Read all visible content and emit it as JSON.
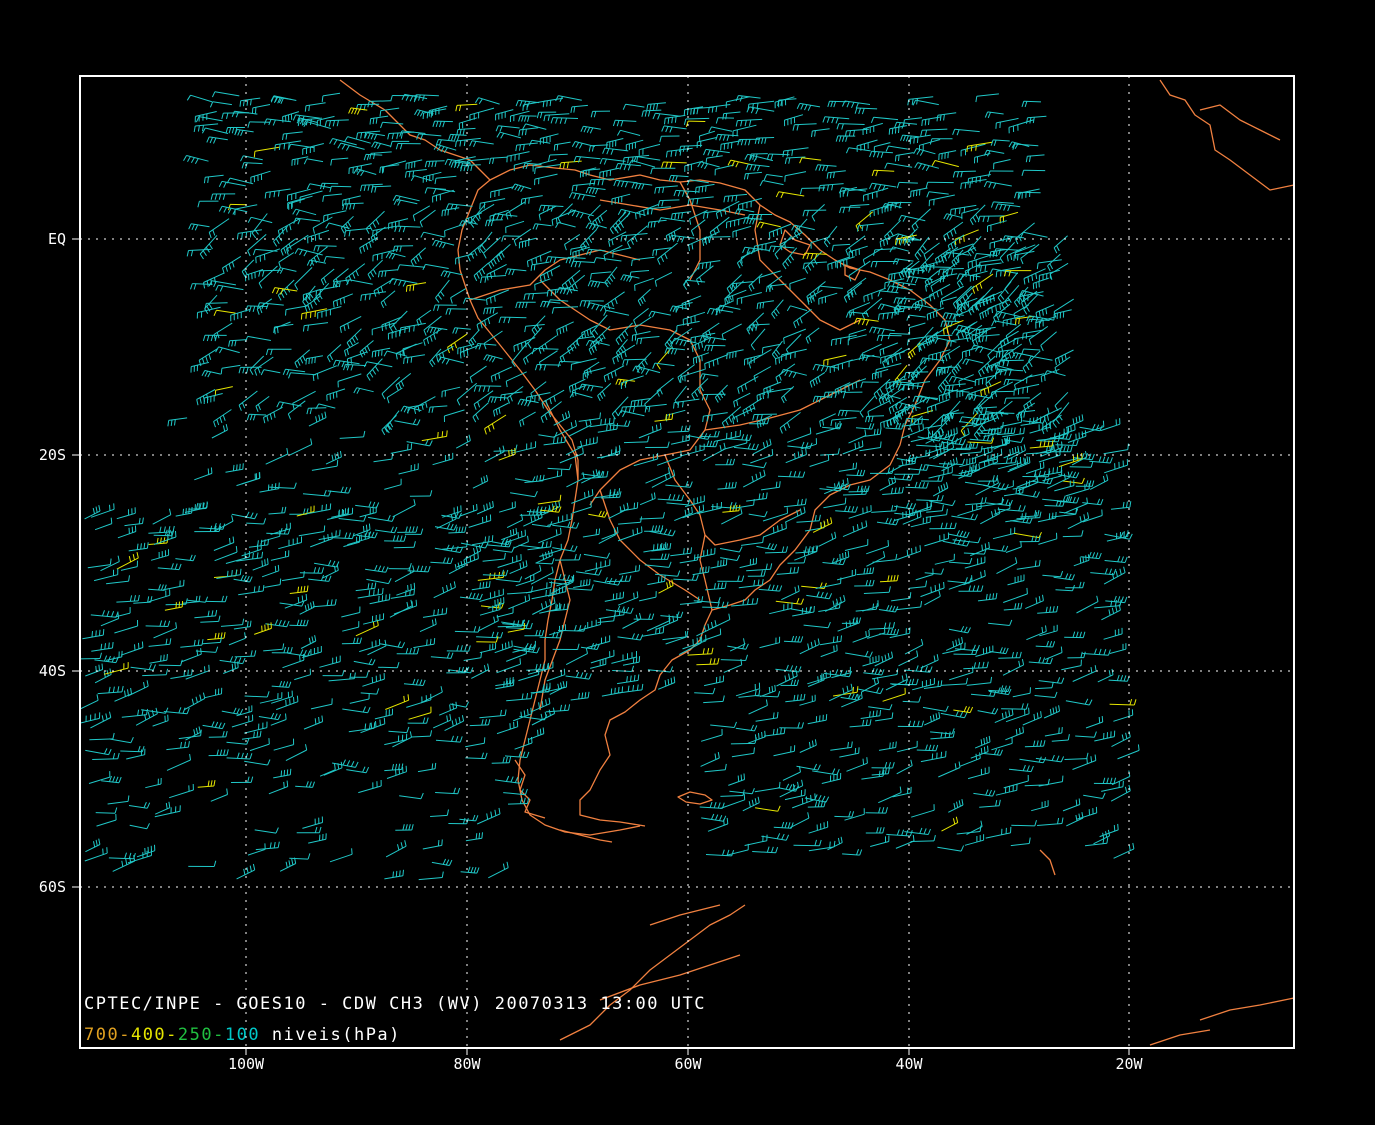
{
  "caption": {
    "line1": "CPTEC/INPE - GOES10 - CDW CH3 (WV) 20070313 13:00 UTC",
    "levels": [
      {
        "text": "700-",
        "color": "#e0a020"
      },
      {
        "text": "400-",
        "color": "#e6e600"
      },
      {
        "text": "250-",
        "color": "#20c040"
      },
      {
        "text": "100",
        "color": "#00c8c8"
      }
    ],
    "levels_suffix": " niveis(hPa)"
  },
  "axes": {
    "lon_labels": [
      "100W",
      "80W",
      "60W",
      "40W",
      "20W"
    ],
    "lat_labels": [
      "EQ",
      "20S",
      "40S",
      "60S"
    ]
  },
  "colors": {
    "background": "#000000",
    "frame": "#ffffff",
    "grid": "#ffffff",
    "coastline": "#f08040",
    "wind_high": "#20c8c8",
    "wind_low": "#e6e600"
  },
  "map": {
    "lon_range": [
      -115,
      -5
    ],
    "lat_range": [
      15,
      -75
    ],
    "projection": "cylindrical",
    "barb_symbol": "wind-barb"
  }
}
